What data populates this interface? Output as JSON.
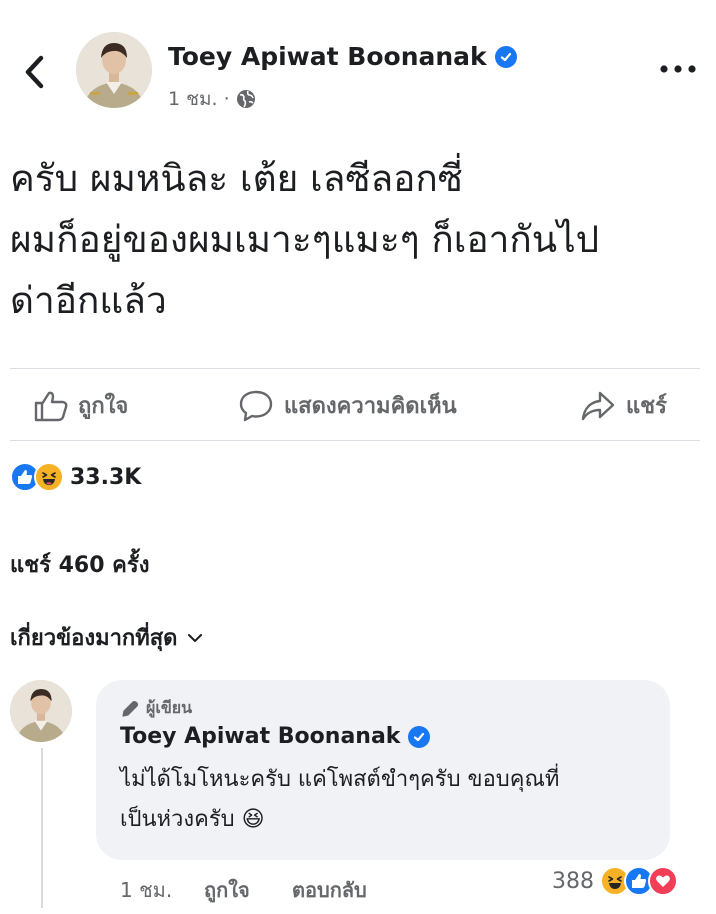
{
  "header": {
    "author_name": "Toey Apiwat Boonanak",
    "time": "1 ชม. ·",
    "privacy_icon": "globe-icon",
    "back_icon": "chevron-left-icon",
    "more_icon": "more-dots-icon"
  },
  "post": {
    "lines": [
      "ครับ ผมหนิละ เต้ย เลซีลอกซี่",
      "ผมก็อยู่ของผมเมาะๆแมะๆ ก็เอากันไป",
      "ด่าอีกแล้ว"
    ]
  },
  "actions": {
    "like_label": "ถูกใจ",
    "comment_label": "แสดงความคิดเห็น",
    "share_label": "แชร์"
  },
  "reactions": {
    "count": "33.3K",
    "types": [
      "like-icon",
      "haha-icon"
    ]
  },
  "shares_text": "แชร์ 460 ครั้ง",
  "comments_sort": {
    "label": "เกี่ยวข้องมากที่สุด",
    "icon": "chevron-down-icon"
  },
  "comment": {
    "badge_label": "ผู้เขียน",
    "author_name": "Toey Apiwat Boonanak",
    "text_lines": [
      "ไม่ได้โมโหนะครับ แค่โพสต์ขำๆครับ ขอบคุณที่",
      "เป็นห่วงครับ 😆"
    ],
    "time": "1 ชม.",
    "like_label": "ถูกใจ",
    "reply_label": "ตอบกลับ",
    "reaction_count": "388",
    "reaction_types": [
      "haha-icon",
      "like-icon",
      "love-icon"
    ]
  },
  "colors": {
    "brand_blue": "#1877f2",
    "secondary_text": "#65676b",
    "bubble_bg": "#f0f2f5",
    "divider": "#dadde1"
  }
}
